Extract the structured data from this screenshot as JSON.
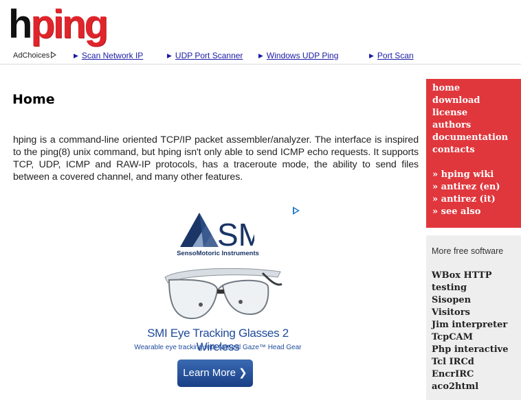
{
  "header": {
    "logo_prefix": "h",
    "logo_suffix": "ping",
    "adchoices": "AdChoices",
    "ad_links": [
      "Scan Network IP",
      "UDP Port Scanner",
      "Windows UDP Ping",
      "Port Scan"
    ]
  },
  "main": {
    "title": "Home",
    "intro": "hping is a command-line oriented TCP/IP packet assembler/analyzer. The interface is inspired to the ping(8) unix command, but hping isn't only able to send ICMP echo requests. It supports TCP, UDP, ICMP and RAW-IP protocols, has a traceroute mode, the ability to send files between a covered channel, and many other features."
  },
  "ad": {
    "brand": "SMI",
    "brand_full": "SensoMotoric Instruments",
    "headline": "SMI Eye Tracking Glasses 2 Wireless",
    "subline": "Wearable eye tracking with Natural Gaze™ Head Gear",
    "button": "Learn More ❯"
  },
  "sidebar": {
    "nav": [
      "home",
      "download",
      "license",
      "authors",
      "documentation",
      "contacts"
    ],
    "links": [
      "» hping wiki",
      "» antirez (en)",
      "» antirez (it)",
      "» see also"
    ],
    "more_title": "More free software",
    "software": [
      "WBox HTTP",
      "testing",
      "Sisopen",
      "Visitors",
      "Jim interpreter",
      "TcpCAM",
      "Php interactive",
      "Tcl IRCd",
      "EncrIRC",
      "aco2html"
    ]
  },
  "colors": {
    "brand_red": "#e0242b",
    "sidebar_red": "#e0373d",
    "link_blue": "#1a1aa6"
  }
}
